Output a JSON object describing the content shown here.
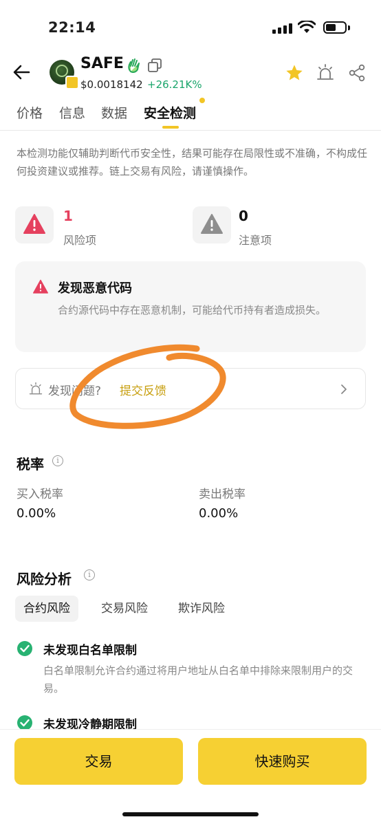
{
  "status_bar": {
    "time": "22:14"
  },
  "token": {
    "name": "SAFE",
    "price": "$0.0018142",
    "change": "+26.21K%"
  },
  "tabs": [
    {
      "label": "价格"
    },
    {
      "label": "信息"
    },
    {
      "label": "数据"
    },
    {
      "label": "安全检测",
      "active": true
    }
  ],
  "disclaimer": "本检测功能仅辅助判断代币安全性，结果可能存在局限性或不准确，不构成任何投资建议或推荐。链上交易有风险，请谨慎操作。",
  "summary": {
    "risk": {
      "count": "1",
      "label": "风险项"
    },
    "notice": {
      "count": "0",
      "label": "注意项"
    }
  },
  "alert": {
    "title": "发现恶意代码",
    "description": "合约源代码中存在恶意机制，可能给代币持有者造成损失。"
  },
  "feedback": {
    "prompt": "发现问题?",
    "link": "提交反馈"
  },
  "tax": {
    "title": "税率",
    "buy_label": "买入税率",
    "buy_value": "0.00%",
    "sell_label": "卖出税率",
    "sell_value": "0.00%"
  },
  "risk_analysis": {
    "title": "风险分析",
    "tabs": [
      {
        "label": "合约风险",
        "active": true
      },
      {
        "label": "交易风险"
      },
      {
        "label": "欺诈风险"
      }
    ],
    "items": [
      {
        "title": "未发现白名单限制",
        "description": "白名单限制允许合约通过将用户地址从白名单中排除来限制用户的交易。"
      },
      {
        "title": "未发现冷静期限制",
        "description": ""
      }
    ]
  },
  "actions": {
    "trade": "交易",
    "quick_buy": "快速购买"
  },
  "colors": {
    "accent": "#f6d033",
    "risk": "#e5405e",
    "success": "#28b272",
    "gain": "#1aa56b",
    "link": "#c8a012"
  }
}
